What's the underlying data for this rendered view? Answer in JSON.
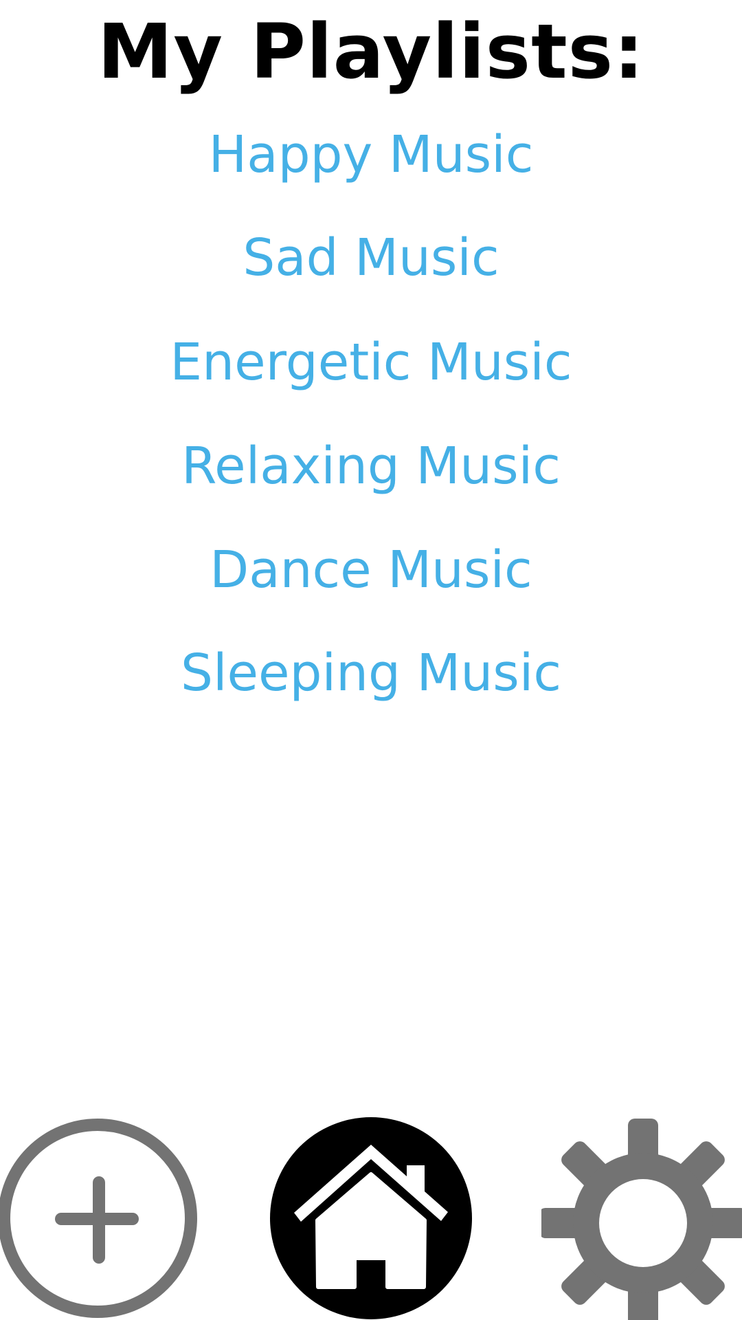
{
  "header": {
    "title": "My Playlists:"
  },
  "playlists": [
    {
      "label": "Happy Music"
    },
    {
      "label": "Sad Music"
    },
    {
      "label": "Energetic Music"
    },
    {
      "label": "Relaxing Music"
    },
    {
      "label": "Dance Music"
    },
    {
      "label": "Sleeping Music"
    }
  ],
  "bottom_nav": {
    "items": [
      {
        "icon": "plus-circle-icon"
      },
      {
        "icon": "home-icon"
      },
      {
        "icon": "gear-icon"
      }
    ]
  },
  "colors": {
    "title": "#000000",
    "playlist_link": "#45b0e6",
    "nav_gray": "#737373",
    "home_background": "#000000"
  }
}
